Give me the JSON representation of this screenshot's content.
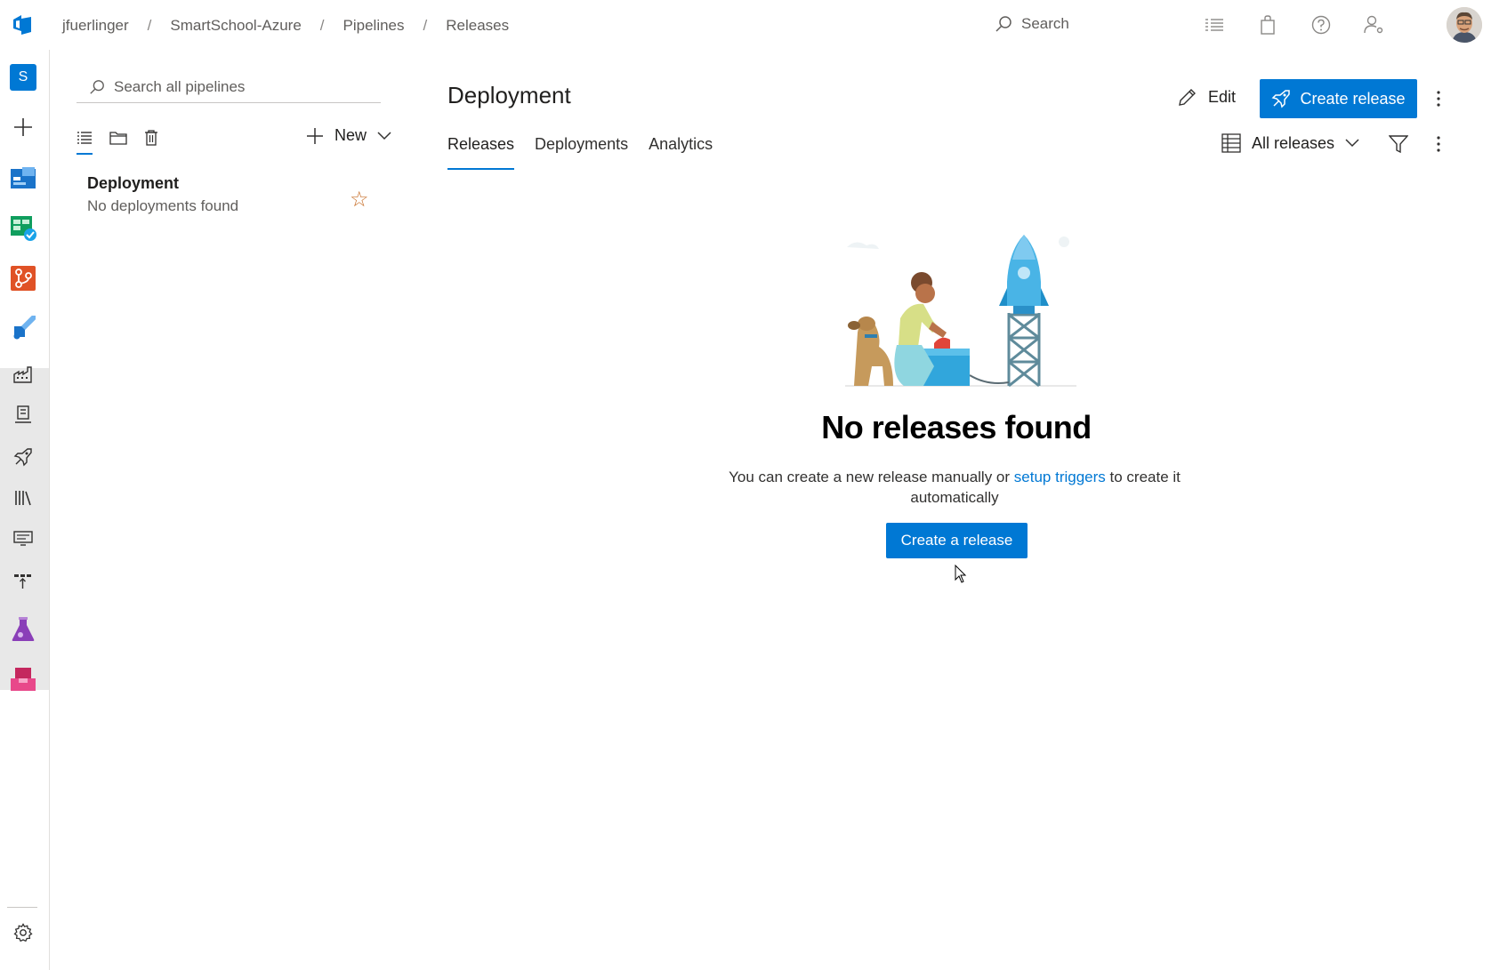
{
  "topbar": {
    "breadcrumb": [
      "jfuerlinger",
      "SmartSchool-Azure",
      "Pipelines",
      "Releases"
    ],
    "separator": "/",
    "search_label": "Search"
  },
  "rail": {
    "project_initial": "S"
  },
  "pipelines_pane": {
    "search_placeholder": "Search all pipelines",
    "new_label": "New",
    "items": [
      {
        "name": "Deployment",
        "status": "No deployments found"
      }
    ]
  },
  "main": {
    "title": "Deployment",
    "edit_label": "Edit",
    "create_release_label": "Create release",
    "tabs": [
      "Releases",
      "Deployments",
      "Analytics"
    ],
    "active_tab": "Releases",
    "view_selector": "All releases"
  },
  "empty_state": {
    "title": "No releases found",
    "text_before": "You can create a new release manually or ",
    "link": "setup triggers",
    "text_after": " to create it automatically",
    "button": "Create a release"
  },
  "colors": {
    "accent": "#0078d4",
    "star": "#c8712c",
    "rail_highlight": "#e8e8e8"
  }
}
